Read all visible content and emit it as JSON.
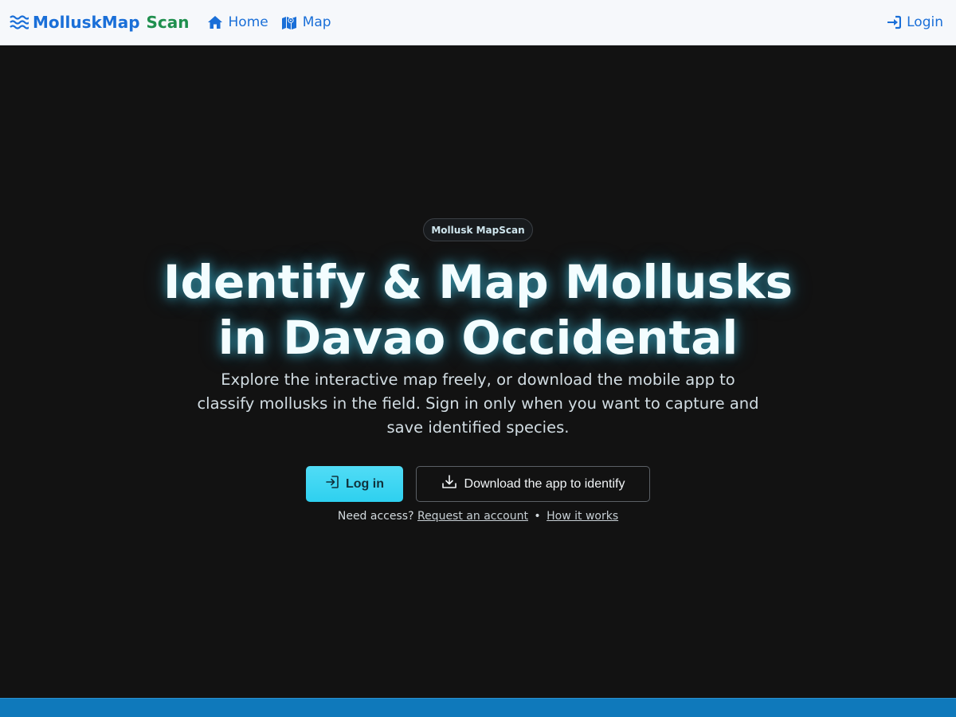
{
  "navbar": {
    "brand_part1": "MolluskMap",
    "brand_part2": "Scan",
    "links": [
      {
        "label": "Home",
        "icon": "home-icon"
      },
      {
        "label": "Map",
        "icon": "map-icon"
      }
    ],
    "login_label": "Login",
    "login_icon": "sign-in-icon"
  },
  "hero": {
    "pill": "Mollusk MapScan",
    "title_line1": "Identify & Map Mollusks",
    "title_line2": "in Davao Occidental",
    "subtitle": "Explore the interactive map freely, or download the mobile app to classify mollusks in the field. Sign in only when you want to capture and save identified species.",
    "login_button": "Log in",
    "download_button": "Download the app to identify",
    "access_prefix": "Need access?",
    "request_link": "Request an account",
    "separator": "•",
    "how_link": "How it works"
  },
  "colors": {
    "brand_blue": "#1a6fd8",
    "brand_green": "#1f8f4e",
    "hero_bg": "#121212",
    "accent_cyan": "#2ed0ef",
    "footer_blue": "#0f79bb"
  }
}
